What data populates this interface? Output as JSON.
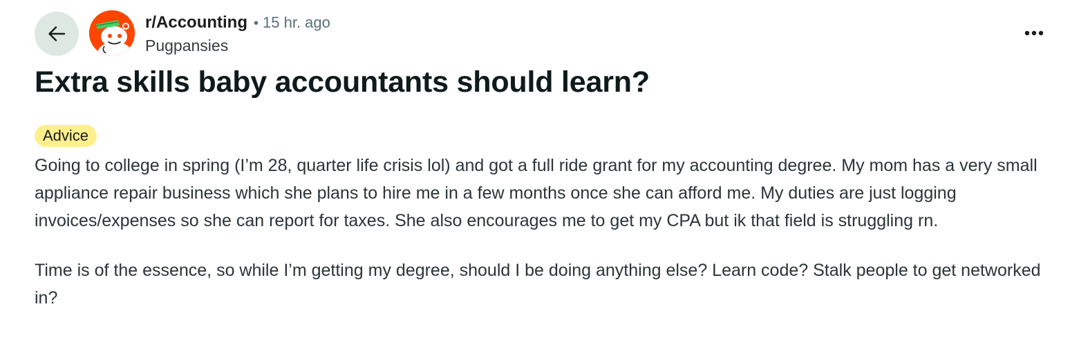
{
  "header": {
    "back_icon": "arrow-left-icon",
    "avatar_icon": "snoo-avatar-icon",
    "subreddit": "r/Accounting",
    "separator": "•",
    "time": "15 hr. ago",
    "author": "Pugpansies",
    "more_icon": "more-horizontal-icon"
  },
  "post": {
    "title": "Extra skills baby accountants should learn?",
    "flair": "Advice",
    "paragraphs": [
      "Going to college in spring (I’m 28, quarter life crisis lol) and got a full ride grant for my accounting degree. My mom has a very small appliance repair business which she plans to hire me in a few months once she can afford me. My duties are just logging invoices/expenses so she can report for taxes. She also encourages me to get my CPA but ik that field is struggling rn.",
      "Time is of the essence, so while I’m getting my degree, should I be doing anything else? Learn code? Stalk people to get networked in?"
    ]
  },
  "colors": {
    "back_button_bg": "#dde8e3",
    "avatar_bg": "#ff4500",
    "flair_bg": "#fdef8c",
    "meta_text": "#576f76"
  }
}
